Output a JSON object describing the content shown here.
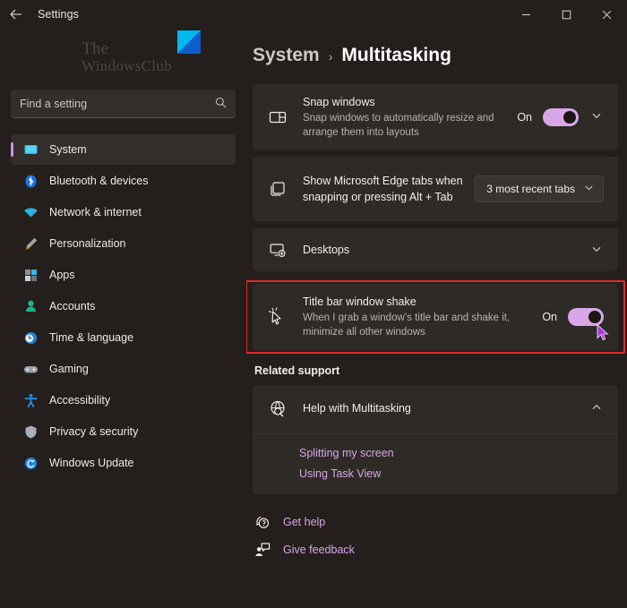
{
  "window": {
    "title": "Settings",
    "back_icon": "arrow-left-icon",
    "controls": [
      {
        "name": "minimize",
        "label": "–"
      },
      {
        "name": "maximize",
        "label": "□"
      },
      {
        "name": "close",
        "label": "✕"
      }
    ]
  },
  "brand": {
    "line1": "The",
    "line2": "WindowsClub"
  },
  "search": {
    "placeholder": "Find a setting",
    "value": "",
    "icon": "search-icon"
  },
  "sidebar": {
    "items": [
      {
        "label": "System",
        "icon": "monitor-icon",
        "active": true
      },
      {
        "label": "Bluetooth & devices",
        "icon": "bluetooth-icon",
        "active": false
      },
      {
        "label": "Network & internet",
        "icon": "wifi-icon",
        "active": false
      },
      {
        "label": "Personalization",
        "icon": "paintbrush-icon",
        "active": false
      },
      {
        "label": "Apps",
        "icon": "apps-grid-icon",
        "active": false
      },
      {
        "label": "Accounts",
        "icon": "person-icon",
        "active": false
      },
      {
        "label": "Time & language",
        "icon": "clock-icon",
        "active": false
      },
      {
        "label": "Gaming",
        "icon": "gamepad-icon",
        "active": false
      },
      {
        "label": "Accessibility",
        "icon": "accessibility-icon",
        "active": false
      },
      {
        "label": "Privacy & security",
        "icon": "shield-icon",
        "active": false
      },
      {
        "label": "Windows Update",
        "icon": "refresh-icon",
        "active": false
      }
    ]
  },
  "breadcrumb": {
    "parent": "System",
    "separator": "›",
    "current": "Multitasking"
  },
  "settings": [
    {
      "id": "snap-windows",
      "icon": "snap-layout-icon",
      "title": "Snap windows",
      "subtitle": "Snap windows to automatically resize and arrange them into layouts",
      "control": "toggle",
      "toggle_state": "On",
      "expand_icon": "chevron-down-icon",
      "highlighted": false
    },
    {
      "id": "edge-tabs",
      "icon": "tabs-icon",
      "title": "Show Microsoft Edge tabs when snapping or pressing Alt + Tab",
      "subtitle": "",
      "control": "dropdown",
      "dropdown_value": "3 most recent tabs",
      "dropdown_icon": "chevron-down-icon",
      "highlighted": false
    },
    {
      "id": "desktops",
      "icon": "desktops-icon",
      "title": "Desktops",
      "subtitle": "",
      "control": "expand",
      "expand_icon": "chevron-down-icon",
      "highlighted": false
    },
    {
      "id": "title-bar-window-shake",
      "icon": "cursor-shake-icon",
      "title": "Title bar window shake",
      "subtitle": "When I grab a window’s title bar and shake it, minimize all other windows",
      "control": "toggle",
      "toggle_state": "On",
      "highlighted": true
    }
  ],
  "related_support": {
    "heading": "Related support",
    "help_icon": "globe-search-icon",
    "help_title": "Help with Multitasking",
    "collapse_icon": "chevron-up-icon",
    "links": [
      "Splitting my screen",
      "Using Task View"
    ]
  },
  "footer": [
    {
      "label": "Get help",
      "icon": "help-question-icon"
    },
    {
      "label": "Give feedback",
      "icon": "feedback-icon"
    }
  ],
  "colors": {
    "background": "#241f1c",
    "card": "#2e2a26",
    "accent": "#d08cea",
    "toggle_on": "#d9a7e8",
    "link": "#d6a8ea",
    "highlight_border": "#e02a2a"
  }
}
